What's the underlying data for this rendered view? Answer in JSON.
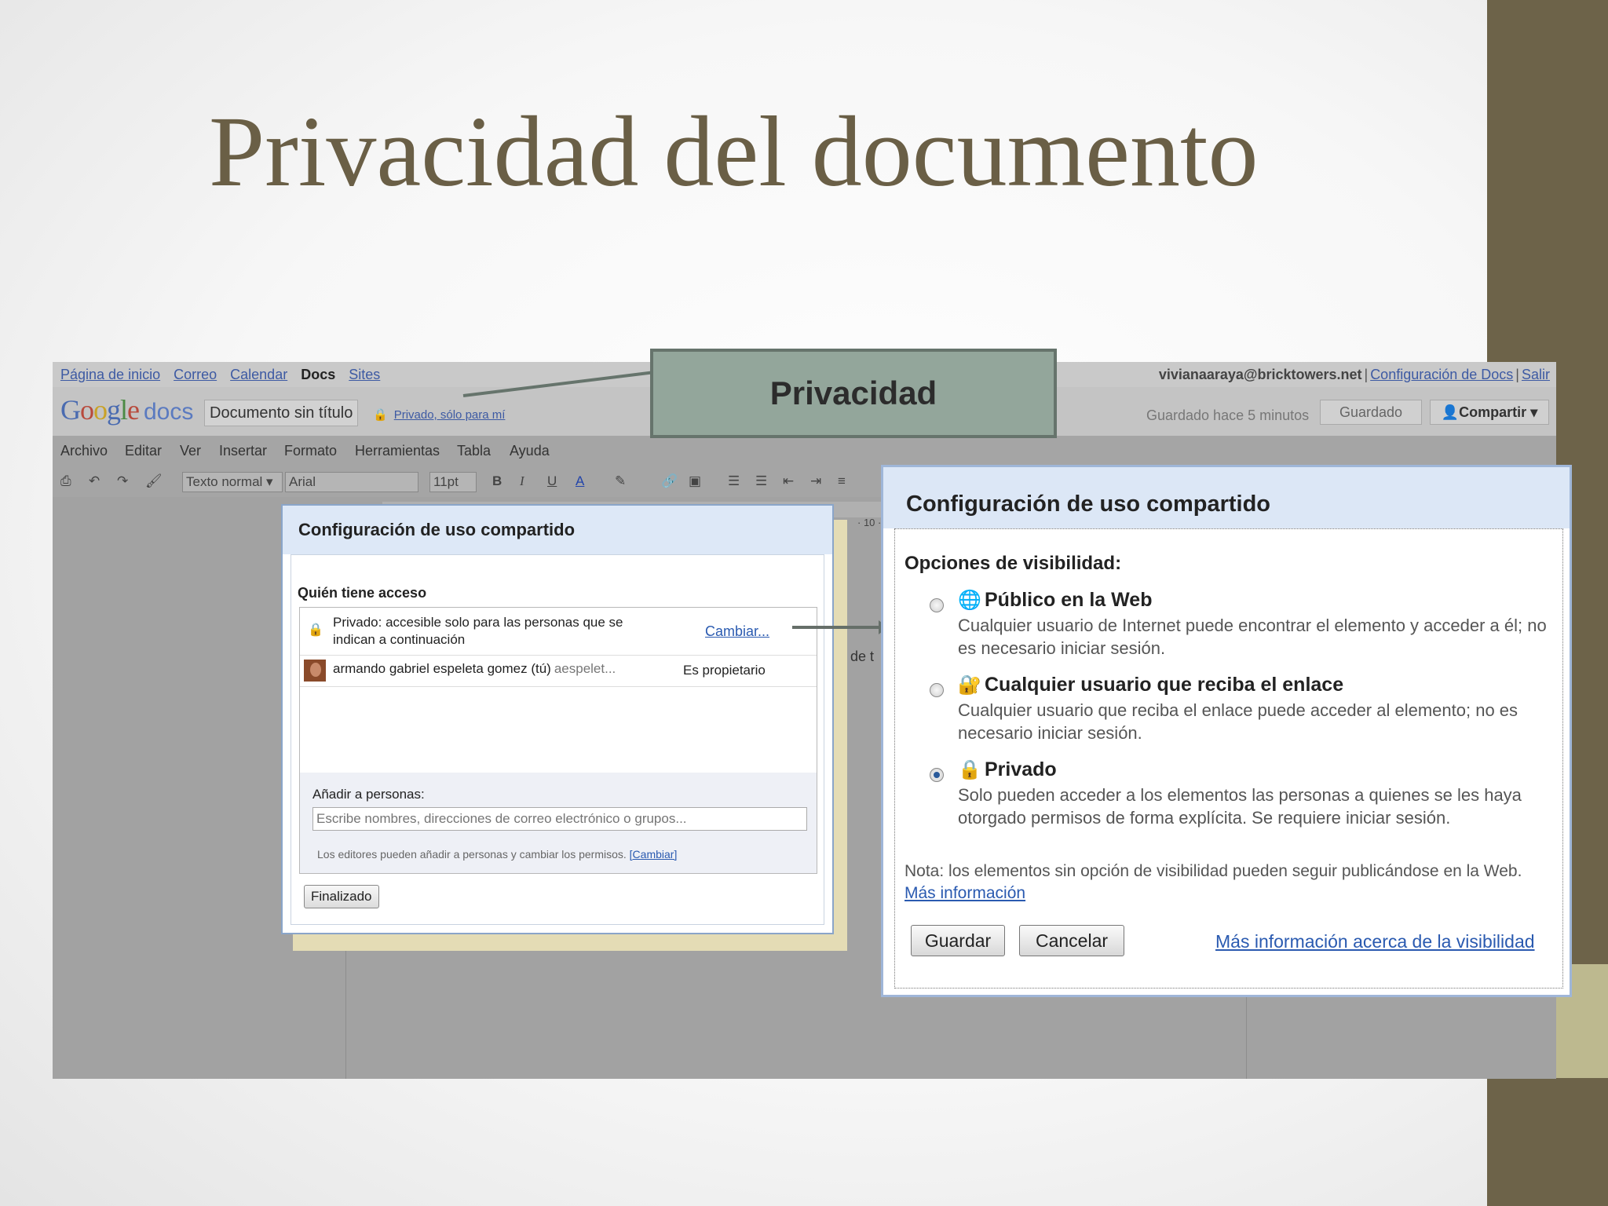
{
  "slide_title": "Privacidad del documento",
  "callout": "Privacidad",
  "gdocs": {
    "nav_links": [
      "Página de inicio",
      "Correo",
      "Calendar",
      "Docs",
      "Sites"
    ],
    "account_email": "vivianaaraya@bricktowers.net",
    "config_link": "Configuración de Docs",
    "logout": "Salir",
    "logo_g1": "G",
    "logo_o1": "o",
    "logo_o2": "o",
    "logo_g2": "g",
    "logo_l": "l",
    "logo_e": "e",
    "logo_docs": "docs",
    "doc_title": "Documento sin título",
    "privacy_link": "Privado, sólo para mí",
    "saved_time": "Guardado hace 5 minutos",
    "saved_button": "Guardado",
    "share_button": "Compartir",
    "menu": [
      "Archivo",
      "Editar",
      "Ver",
      "Insertar",
      "Formato",
      "Herramientas",
      "Tabla",
      "Ayuda"
    ],
    "toolbar": {
      "style": "Texto normal",
      "font": "Arial",
      "size": "11pt",
      "bold": "B",
      "italic": "I",
      "underline": "U",
      "text_color": "A"
    },
    "doc_peek": "de t",
    "ruler_num": "· 10 ·"
  },
  "share_small": {
    "title": "Configuración de uso compartido",
    "who_has_access": "Quién tiene acceso",
    "private_text": "Privado: accesible solo para las personas que se indican a continuación",
    "change_link": "Cambiar...",
    "user_name": "armando gabriel espeleta gomez (tú)",
    "user_email": "aespelet...",
    "user_role": "Es propietario",
    "add_people_label": "Añadir a personas:",
    "add_people_placeholder": "Escribe nombres, direcciones de correo electrónico o grupos...",
    "editors_note": "Los editores pueden añadir a personas y cambiar los permisos.",
    "editors_change": "[Cambiar]",
    "done_button": "Finalizado"
  },
  "share_large": {
    "title": "Configuración de uso compartido",
    "visibility_label": "Opciones de visibilidad:",
    "options": [
      {
        "title": "Público en la Web",
        "desc": "Cualquier usuario de Internet puede encontrar el elemento y acceder a él; no es necesario iniciar sesión.",
        "selected": false,
        "icon": "globe-icon"
      },
      {
        "title": "Cualquier usuario que reciba el enlace",
        "desc": "Cualquier usuario que reciba el enlace puede acceder al elemento; no es necesario iniciar sesión.",
        "selected": false,
        "icon": "link-lock-icon"
      },
      {
        "title": "Privado",
        "desc": "Solo pueden acceder a los elementos las personas a quienes se les haya otorgado permisos de forma explícita. Se requiere iniciar sesión.",
        "selected": true,
        "icon": "lock-icon"
      }
    ],
    "note": "Nota: los elementos sin opción de visibilidad pueden seguir publicándose en la Web.",
    "note_link": "Más información",
    "save_button": "Guardar",
    "cancel_button": "Cancelar",
    "more_visibility_link": "Más información acerca de la visibilidad"
  },
  "colors": {
    "accent_bar": "#6d6349",
    "title_color": "#6a5f46",
    "callout_bg": "#93a69b",
    "link": "#2a5ab0"
  }
}
